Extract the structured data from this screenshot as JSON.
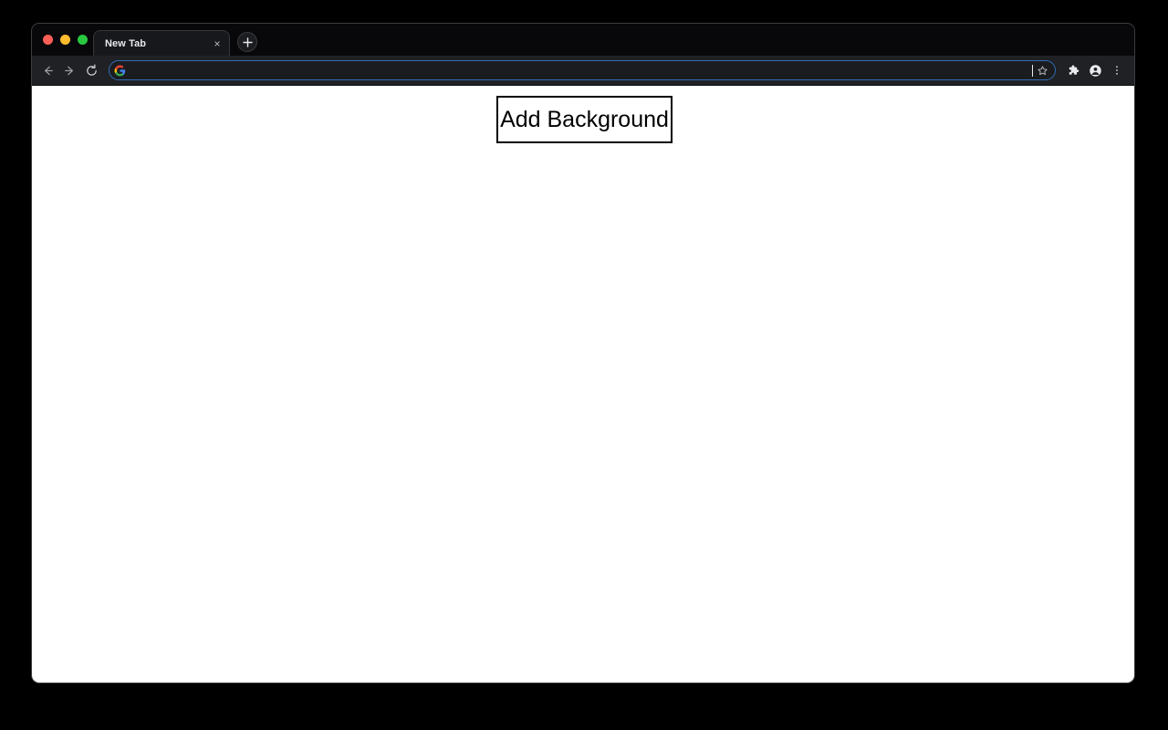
{
  "window": {
    "traffic_lights": [
      {
        "name": "close",
        "color": "#ff5f57"
      },
      {
        "name": "minimize",
        "color": "#febc2e"
      },
      {
        "name": "maximize",
        "color": "#28c840"
      }
    ]
  },
  "tabstrip": {
    "tabs": [
      {
        "title": "New Tab",
        "close_label": "×",
        "active": true
      }
    ],
    "new_tab_label": "+"
  },
  "toolbar": {
    "back_label": "Back",
    "forward_label": "Forward",
    "reload_label": "Reload",
    "bookmark_label": "Bookmark this tab",
    "extensions_label": "Extensions",
    "profile_label": "Profile",
    "menu_label": "Customize and control Google Chrome"
  },
  "omnibox": {
    "value": "",
    "placeholder": "",
    "site_icon": "google-g-icon",
    "focused": true
  },
  "page": {
    "background_color": "#ffffff",
    "add_background_button_label": "Add Background"
  }
}
